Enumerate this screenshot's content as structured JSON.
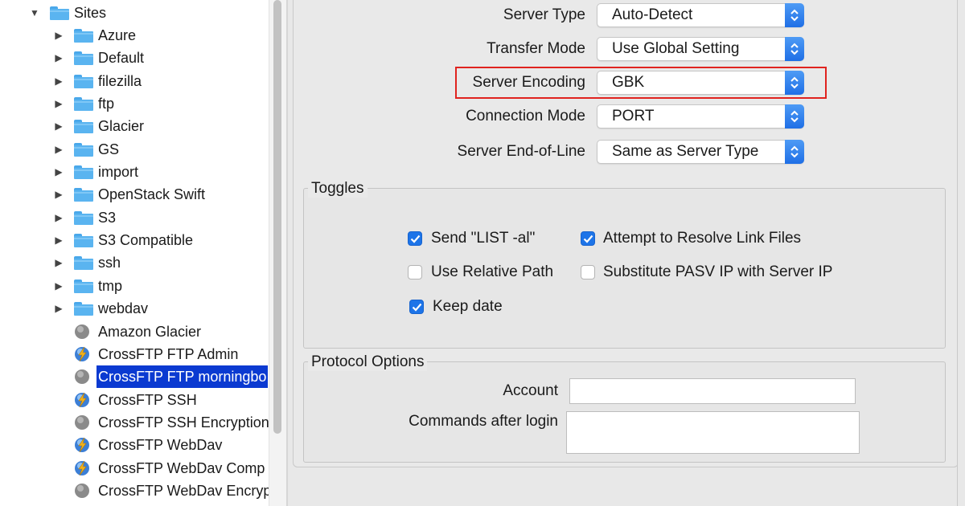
{
  "tree": {
    "root": {
      "label": "Sites",
      "expanded": true
    },
    "folders": [
      "Azure",
      "Default",
      "filezilla",
      "ftp",
      "Glacier",
      "GS",
      "import",
      "OpenStack Swift",
      "S3",
      "S3 Compatible",
      "ssh",
      "tmp",
      "webdav"
    ],
    "sites": [
      {
        "label": "Amazon Glacier",
        "icon": "gray-globe-icon"
      },
      {
        "label": "CrossFTP FTP Admin",
        "icon": "lightning-globe-icon"
      },
      {
        "label": "CrossFTP FTP morningbo",
        "icon": "gray-globe-icon",
        "selected": true
      },
      {
        "label": "CrossFTP SSH",
        "icon": "lightning-globe-icon"
      },
      {
        "label": "CrossFTP SSH Encryption",
        "icon": "gray-globe-icon"
      },
      {
        "label": "CrossFTP WebDav",
        "icon": "lightning-globe-icon"
      },
      {
        "label": "CrossFTP WebDav Comp",
        "icon": "lightning-globe-icon"
      },
      {
        "label": "CrossFTP WebDav Encryp",
        "icon": "gray-globe-icon"
      }
    ]
  },
  "settings": {
    "server_type": {
      "label": "Server Type",
      "value": "Auto-Detect"
    },
    "transfer_mode": {
      "label": "Transfer Mode",
      "value": "Use Global Setting"
    },
    "server_encoding": {
      "label": "Server Encoding",
      "value": "GBK"
    },
    "connection_mode": {
      "label": "Connection Mode",
      "value": "PORT"
    },
    "server_eol": {
      "label": "Server End-of-Line",
      "value": "Same as Server Type"
    }
  },
  "toggles": {
    "title": "Toggles",
    "send_list": {
      "label": "Send \"LIST -al\"",
      "checked": true
    },
    "resolve_links": {
      "label": "Attempt to Resolve Link Files",
      "checked": true
    },
    "relative_path": {
      "label": "Use Relative Path",
      "checked": false
    },
    "substitute_pasv": {
      "label": "Substitute PASV IP with Server IP",
      "checked": false
    },
    "keep_date": {
      "label": "Keep date",
      "checked": true
    }
  },
  "protocol": {
    "title": "Protocol Options",
    "account_label": "Account",
    "account_value": "",
    "commands_label": "Commands after login",
    "commands_value": ""
  },
  "colors": {
    "selection": "#0b3ad1",
    "accent": "#1d74e8",
    "highlight_box": "#e0231f",
    "folder": "#5ab4f0"
  }
}
